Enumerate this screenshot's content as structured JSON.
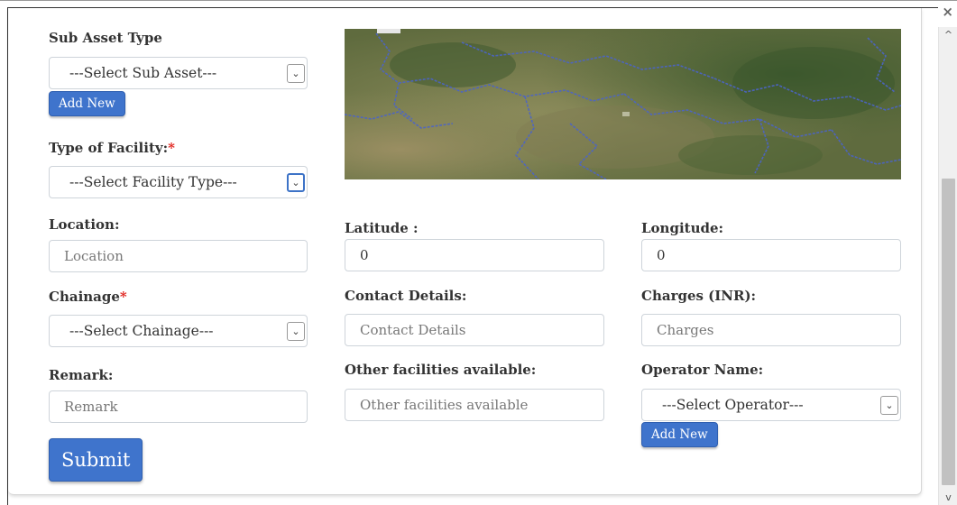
{
  "window": {
    "close_glyph": "×"
  },
  "scrollbar": {
    "up_glyph": "^",
    "down_glyph": "v"
  },
  "sub_asset": {
    "label": "Sub Asset Type",
    "selected": "---Select Sub Asset---",
    "add_label": "Add New"
  },
  "facility": {
    "label": "Type of Facility:",
    "required_mark": "*",
    "selected": "---Select Facility Type---"
  },
  "location": {
    "label": "Location:",
    "placeholder": "Location"
  },
  "latitude": {
    "label": "Latitude :",
    "value": "0"
  },
  "longitude": {
    "label": "Longitude:",
    "value": "0"
  },
  "chainage": {
    "label": "Chainage",
    "required_mark": "*",
    "selected": "---Select Chainage---"
  },
  "contact": {
    "label": "Contact Details:",
    "placeholder": "Contact Details"
  },
  "charges": {
    "label": "Charges (INR):",
    "placeholder": "Charges"
  },
  "remark": {
    "label": "Remark:",
    "placeholder": "Remark"
  },
  "other_facilities": {
    "label": "Other facilities available:",
    "placeholder": "Other facilities available"
  },
  "operator": {
    "label": "Operator Name:",
    "selected": "---Select Operator---",
    "add_label": "Add New"
  },
  "submit_label": "Submit",
  "map": {
    "icon": "satellite-map"
  },
  "colors": {
    "primary": "#3f74cc",
    "required": "#e0201a",
    "map_border": "#4b64c8"
  }
}
